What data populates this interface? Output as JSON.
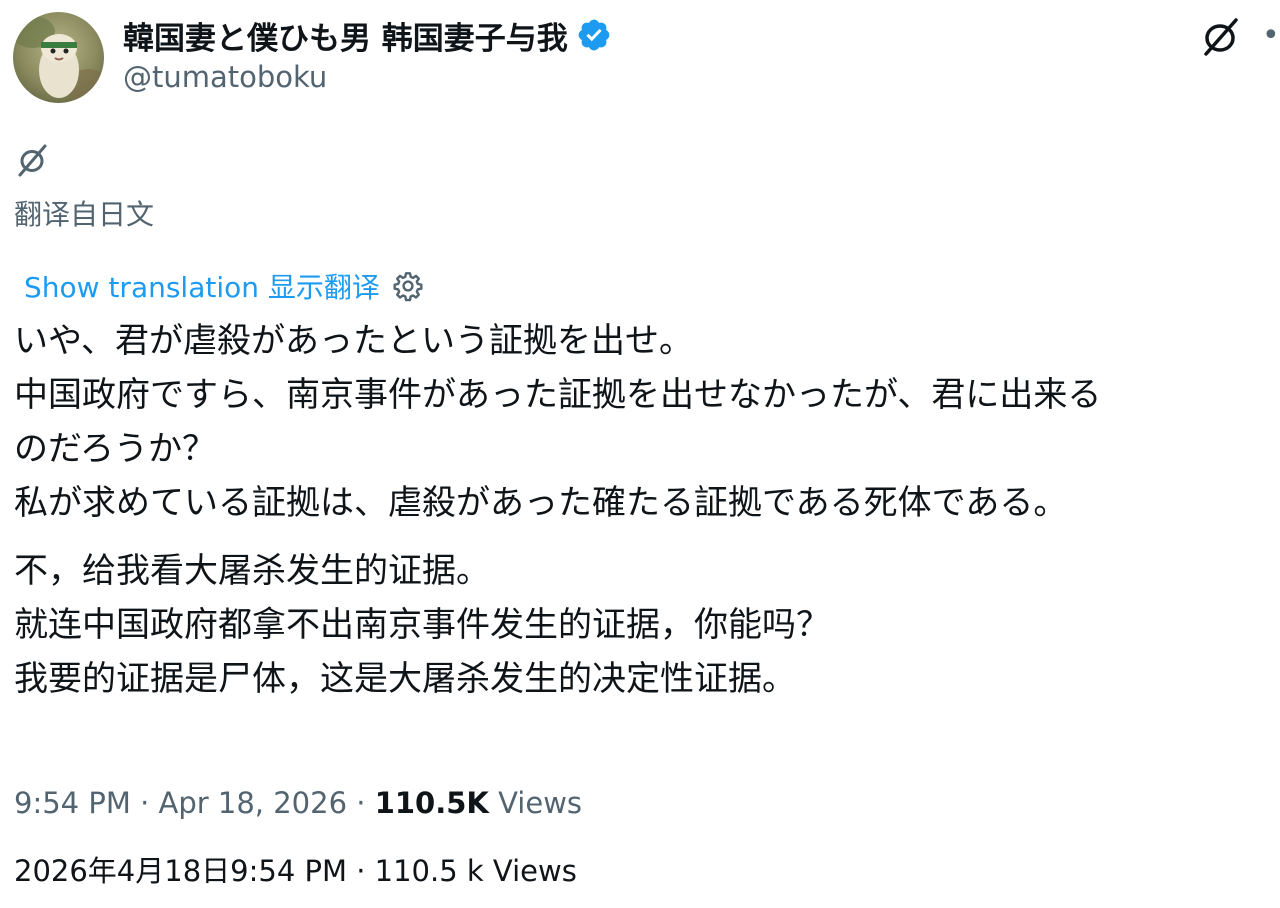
{
  "author": {
    "display_name": "韓国妻と僕ひも男 韩国妻子与我",
    "handle": "@tumatoboku",
    "avatar_icon": "avatar-image",
    "verified_icon": "verified-badge-icon",
    "verified_color": "#1d9bf0"
  },
  "header": {
    "translate_icon": "translate-icon",
    "more_icon": "more-icon"
  },
  "translation_info": {
    "icon": "translate-icon",
    "translated_from": "翻译自日文",
    "show_translation": "Show translation 显示翻译",
    "settings_icon": "gear-icon",
    "link_color": "#1d9bf0"
  },
  "tweet": {
    "original_lines": [
      "いや、君が虐殺があったという証拠を出せ。",
      "中国政府ですら、南京事件があった証拠を出せなかったが、君に出来る",
      "のだろうか？",
      "私が求めている証拠は、虐殺があった確たる証拠である死体である。"
    ],
    "translated_lines": [
      "不，给我看大屠杀发生的证据。",
      "就连中国政府都拿不出南京事件发生的证据，你能吗？",
      "我要的证据是尸体，这是大屠杀发生的决定性证据。"
    ]
  },
  "meta": {
    "time_date": "9:54 PM · Apr 18, 2026 · ",
    "views_count": "110.5K",
    "views_label": " Views",
    "translated_meta": "2026年4月18日9:54 PM · 110.5 k Views"
  }
}
